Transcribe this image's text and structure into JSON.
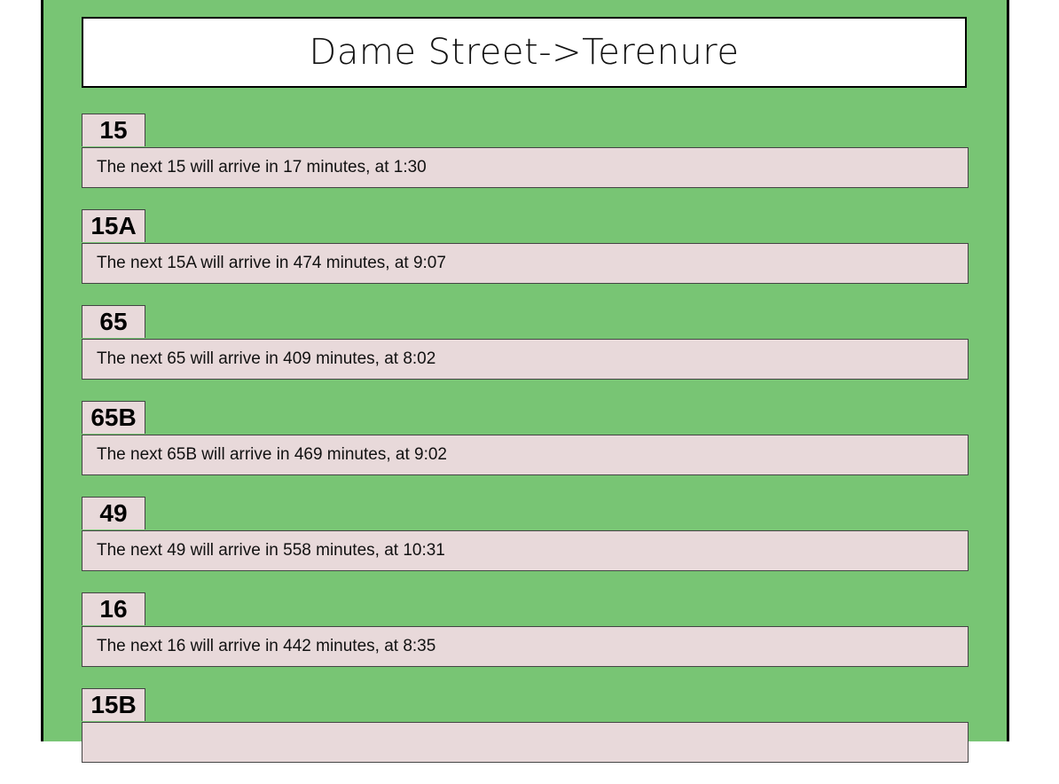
{
  "header": {
    "title": "Dame Street->Terenure"
  },
  "routes": [
    {
      "number": "15",
      "message": "The next 15 will arrive in 17 minutes, at 1:30"
    },
    {
      "number": "15A",
      "message": "The next 15A will arrive in 474 minutes, at 9:07"
    },
    {
      "number": "65",
      "message": "The next 65 will arrive in 409 minutes, at 8:02"
    },
    {
      "number": "65B",
      "message": "The next 65B will arrive in 469 minutes, at 9:02"
    },
    {
      "number": "49",
      "message": "The next 49 will arrive in 558 minutes, at 10:31"
    },
    {
      "number": "16",
      "message": "The next 16 will arrive in 442 minutes, at 8:35"
    },
    {
      "number": "15B",
      "message": ""
    }
  ],
  "colors": {
    "panel_background": "#78c574",
    "card_background": "#e8d9da"
  }
}
